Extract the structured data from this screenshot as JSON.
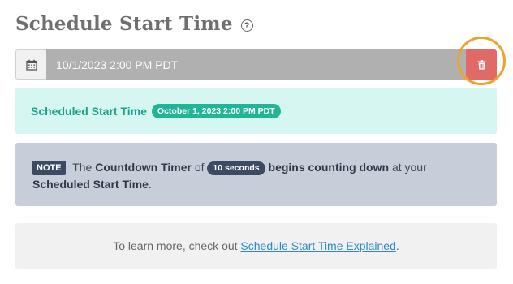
{
  "section": {
    "title": "Schedule Start Time",
    "help_glyph": "?"
  },
  "date_input": {
    "value": "10/1/2023 2:00 PM PDT",
    "calendar_icon": "calendar-icon",
    "delete_icon": "trash-icon",
    "delete_color": "#e06b66",
    "highlight_ring_color": "#f0a22a"
  },
  "scheduled": {
    "label": "Scheduled Start Time",
    "badge": "October 1, 2023 2:00 PM PDT",
    "accent": "#1fb597"
  },
  "note": {
    "badge": "NOTE",
    "t1": "The",
    "b1": "Countdown Timer",
    "t2": "of",
    "pill": "10 seconds",
    "b2": "begins counting down",
    "t3": "at your",
    "b3": "Scheduled Start Time",
    "t4": "."
  },
  "info": {
    "prefix": "To learn more, check out ",
    "link": "Schedule Start Time Explained",
    "suffix": "."
  }
}
